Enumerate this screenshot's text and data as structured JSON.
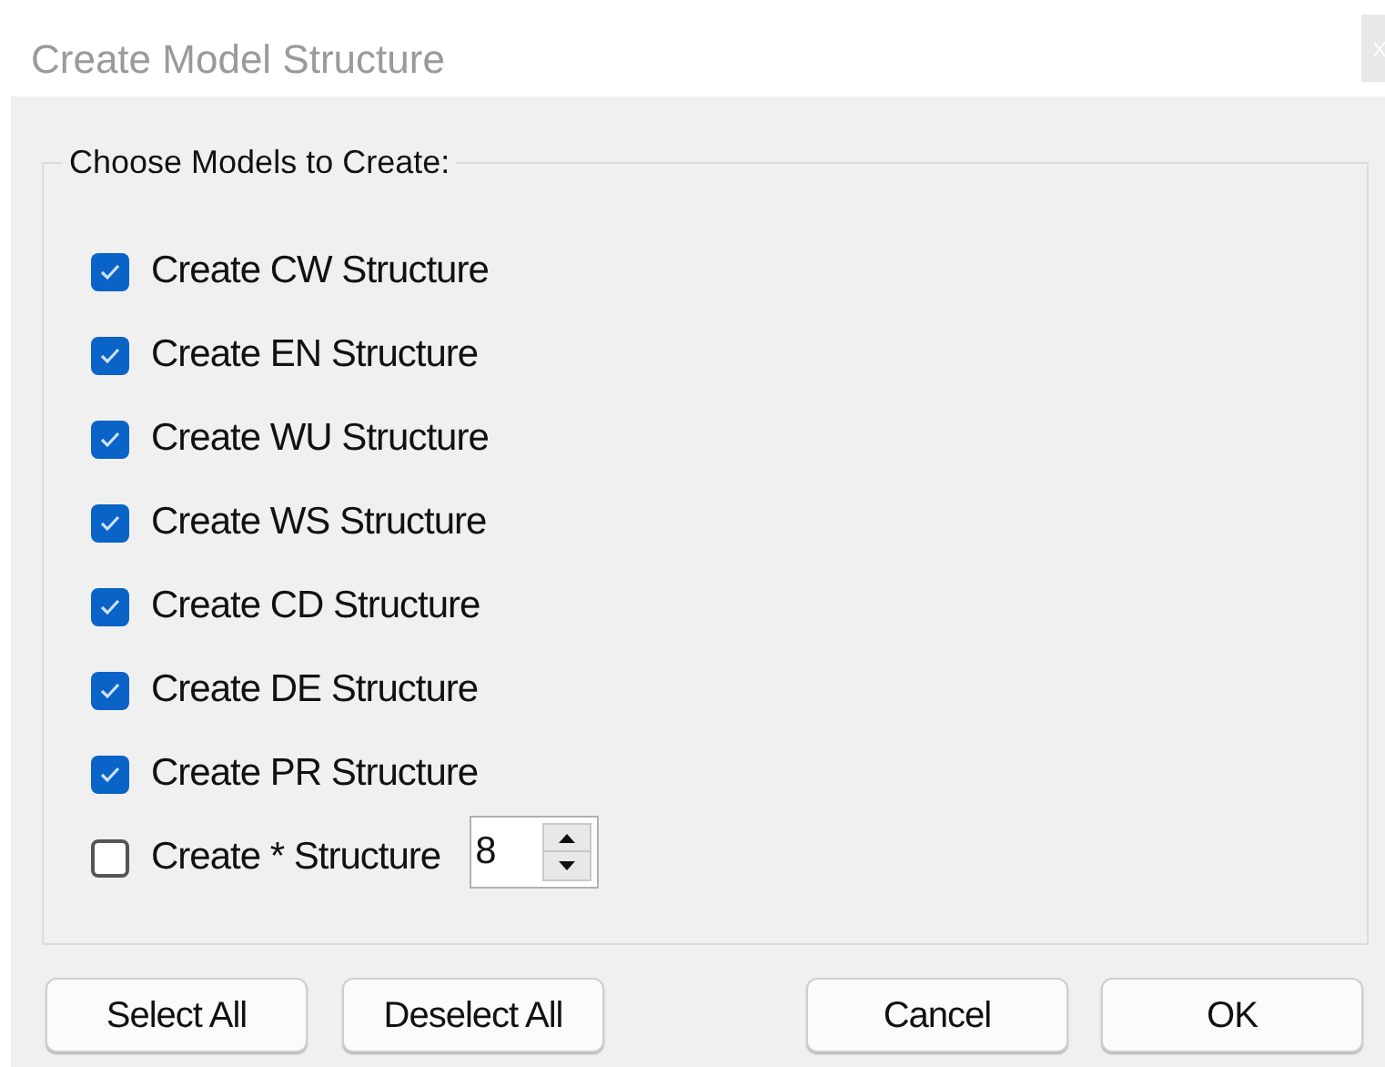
{
  "window": {
    "title": "Create Model Structure"
  },
  "group": {
    "label": "Choose Models to Create:"
  },
  "options": [
    {
      "kind": "checkbox",
      "label": "Create CW Structure",
      "checked": true
    },
    {
      "kind": "checkbox",
      "label": "Create EN Structure",
      "checked": true
    },
    {
      "kind": "checkbox",
      "label": "Create WU Structure",
      "checked": true
    },
    {
      "kind": "checkbox",
      "label": "Create WS Structure",
      "checked": true
    },
    {
      "kind": "checkbox",
      "label": "Create CD Structure",
      "checked": true
    },
    {
      "kind": "checkbox",
      "label": "Create DE Structure",
      "checked": true
    },
    {
      "kind": "checkbox",
      "label": "Create PR Structure",
      "checked": true
    },
    {
      "kind": "checkbox_spinner",
      "label": "Create * Structure",
      "checked": false,
      "value": "8"
    }
  ],
  "buttons_left": [
    "Select All",
    "Deselect All"
  ],
  "buttons_right": [
    "Cancel",
    "OK"
  ]
}
